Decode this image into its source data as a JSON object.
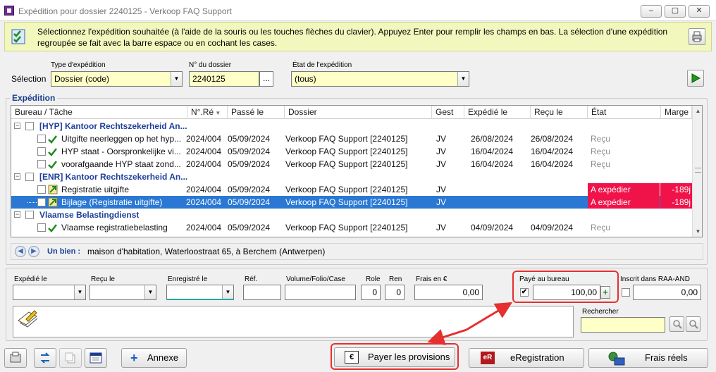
{
  "window": {
    "title": "Expédition pour dossier 2240125 - Verkoop FAQ Support",
    "minimize": "–",
    "maximize": "▢",
    "close": "✕"
  },
  "info": {
    "text": "Sélectionnez l'expédition souhaitée (à l'aide de la souris ou les touches flèches du clavier). Appuyez Enter pour remplir les champs en bas. La sélection d'une expédition regroupée se fait avec la barre espace ou en cochant les cases."
  },
  "selection": {
    "label": "Sélection",
    "type_label": "Type d'expédition",
    "type_value": "Dossier (code)",
    "dossier_label": "N° du dossier",
    "dossier_value": "2240125",
    "dossier_btn": "...",
    "state_label": "État de l'expédition",
    "state_value": "(tous)"
  },
  "expedition": {
    "title": "Expédition",
    "columns": [
      "Bureau / Tâche",
      "N°.Ré",
      "Passé le",
      "Dossier",
      "Gest",
      "Expédié le",
      "Reçu le",
      "État",
      "Marge"
    ],
    "groups": [
      {
        "name": "[HYP] Kantoor Rechtszekerheid An..."
      },
      {
        "name": "[ENR] Kantoor Rechtszekerheid An..."
      },
      {
        "name": "Vlaamse Belastingdienst"
      }
    ],
    "rows": [
      {
        "task": "Uitgifte neerleggen op het hyp...",
        "nre": "2024/004",
        "passe": "05/09/2024",
        "dossier": "Verkoop FAQ Support [2240125]",
        "gest": "JV",
        "expedie": "26/08/2024",
        "recu": "26/08/2024",
        "etat": "Reçu",
        "marge": ""
      },
      {
        "task": "HYP staat - Oorspronkelijke vi...",
        "nre": "2024/004",
        "passe": "05/09/2024",
        "dossier": "Verkoop FAQ Support [2240125]",
        "gest": "JV",
        "expedie": "16/04/2024",
        "recu": "16/04/2024",
        "etat": "Reçu",
        "marge": ""
      },
      {
        "task": "voorafgaande HYP staat zond...",
        "nre": "2024/004",
        "passe": "05/09/2024",
        "dossier": "Verkoop FAQ Support [2240125]",
        "gest": "JV",
        "expedie": "16/04/2024",
        "recu": "16/04/2024",
        "etat": "Reçu",
        "marge": ""
      },
      {
        "task": "Registratie uitgifte",
        "nre": "2024/004",
        "passe": "05/09/2024",
        "dossier": "Verkoop FAQ Support [2240125]",
        "gest": "JV",
        "expedie": "",
        "recu": "",
        "etat": "A expédier",
        "marge": "-189j"
      },
      {
        "task": "Bijlage (Registratie uitgifte)",
        "nre": "2024/004",
        "passe": "05/09/2024",
        "dossier": "Verkoop FAQ Support [2240125]",
        "gest": "JV",
        "expedie": "",
        "recu": "",
        "etat": "A expédier",
        "marge": "-189j"
      },
      {
        "task": "Vlaamse registratiebelasting",
        "nre": "2024/004",
        "passe": "05/09/2024",
        "dossier": "Verkoop FAQ Support [2240125]",
        "gest": "JV",
        "expedie": "04/09/2024",
        "recu": "04/09/2024",
        "etat": "Reçu",
        "marge": ""
      }
    ]
  },
  "bien": {
    "label": "Un bien :",
    "value": "maison d'habitation, Waterloostraat 65, à Berchem (Antwerpen)"
  },
  "form": {
    "expedie_label": "Expédié le",
    "recu_label": "Reçu le",
    "enregistre_label": "Enregistré le",
    "ref_label": "Réf.",
    "volume_label": "Volume/Folio/Case",
    "role_label": "Role",
    "role_value": "0",
    "ren_label": "Ren",
    "ren_value": "0",
    "frais_label": "Frais en €",
    "frais_value": "0,00",
    "paye_label": "Payé au bureau",
    "paye_value": "100,00",
    "paye_checked": "✔",
    "inscrit_label": "Inscrit dans RAA-AND",
    "inscrit_value": "0,00",
    "rechercher_label": "Rechercher"
  },
  "buttons": {
    "annexe": "Annexe",
    "payer": "Payer les provisions",
    "eregistration": "eRegistration",
    "eregistration_badge": "eR",
    "frais_reels": "Frais réels"
  },
  "colors": {
    "info_bg": "#f2f7bd",
    "field_bg": "#ffffc8",
    "group_text": "#1f3f9a",
    "selected_row": "#2a78d4",
    "status_red": "#f0134a",
    "highlight": "#e53030"
  }
}
